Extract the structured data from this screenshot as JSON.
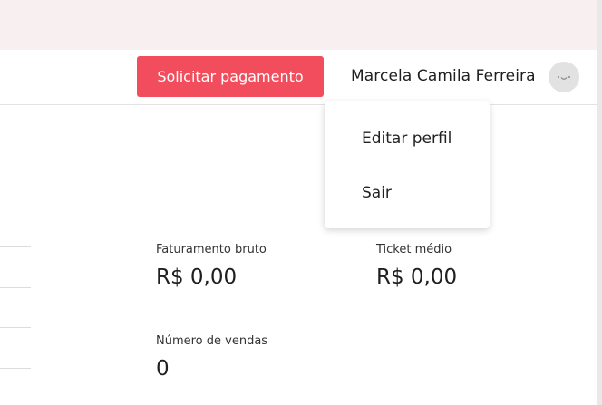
{
  "header": {
    "request_payment_label": "Solicitar pagamento",
    "user_name": "Marcela Camila Ferreira"
  },
  "user_menu": {
    "items": [
      {
        "label": "Editar perfil"
      },
      {
        "label": "Sair"
      }
    ]
  },
  "metrics": {
    "gross_revenue": {
      "label": "Faturamento bruto",
      "value": "R$ 0,00"
    },
    "average_ticket": {
      "label": "Ticket médio",
      "value": "R$ 0,00"
    },
    "sales_count": {
      "label": "Número de vendas",
      "value": "0"
    }
  },
  "colors": {
    "accent": "#f14d5d",
    "top_strip": "#f8f0f0",
    "avatar_bg": "#e2e2e2"
  }
}
